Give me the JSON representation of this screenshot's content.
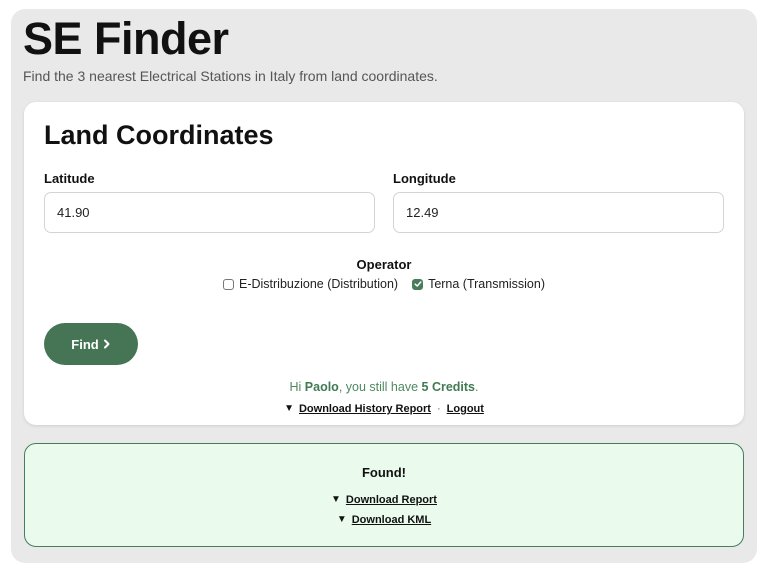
{
  "header": {
    "title": "SE Finder",
    "subtitle": "Find the 3 nearest Electrical Stations in Italy from land coordinates."
  },
  "form": {
    "title": "Land Coordinates",
    "latitude": {
      "label": "Latitude",
      "value": "41.90"
    },
    "longitude": {
      "label": "Longitude",
      "value": "12.49"
    },
    "operator": {
      "label": "Operator",
      "options": [
        {
          "label": "E-Distribuzione (Distribution)",
          "checked": false
        },
        {
          "label": "Terna (Transmission)",
          "checked": true
        }
      ]
    },
    "find_label": "Find",
    "greeting": {
      "prefix": "Hi ",
      "name": "Paolo",
      "middle": ", you still have ",
      "credits": "5 Credits",
      "suffix": "."
    },
    "history_link": "Download History Report",
    "separator": "·",
    "logout_link": "Logout"
  },
  "result": {
    "status": "Found!",
    "report_link": "Download Report",
    "kml_link": "Download KML"
  },
  "icons": {
    "download": "triangle-down-icon",
    "find": "chevron-right-icon",
    "check": "check-icon"
  },
  "colors": {
    "page_bg": "#e9e9e9",
    "accent": "#467556",
    "greeting_text": "#4d8a5f",
    "result_bg": "#eafbee",
    "result_border": "#4a7c5c"
  }
}
